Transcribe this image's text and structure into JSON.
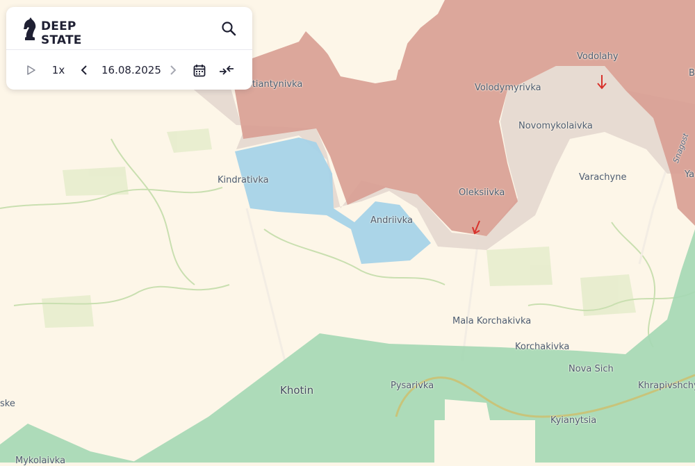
{
  "app": {
    "logo_line1": "DEEP",
    "logo_line2": "STATE"
  },
  "controls": {
    "playback_speed": "1x",
    "date": "16.08.2025"
  },
  "icons": [
    "knight-logo-icon",
    "search-icon",
    "play-icon",
    "chevron-left-icon",
    "chevron-right-icon",
    "calendar-icon",
    "compress-arrows-icon",
    "movement-arrow-icon"
  ],
  "colors": {
    "background": "#fdf6e8",
    "occupied": "#d9a094",
    "contested": "#e4d8cf",
    "liberated": "#a7d3e8",
    "ukraine_controlled": "#a6d8b4",
    "arrow": "#d8312b"
  },
  "map": {
    "places": [
      {
        "id": "kostiantynivka",
        "label": "stiantynivka"
      },
      {
        "id": "vodolahy",
        "label": "Vodolahy"
      },
      {
        "id": "volodymyrivka",
        "label": "Volodymyrivka"
      },
      {
        "id": "novomykolaivka",
        "label": "Novomykolaivka"
      },
      {
        "id": "kindrativka",
        "label": "Kindrativka"
      },
      {
        "id": "varachyne",
        "label": "Varachyne"
      },
      {
        "id": "oleksiivka",
        "label": "Oleksiivka"
      },
      {
        "id": "andriivka",
        "label": "Andriivka"
      },
      {
        "id": "mala-korchakivka",
        "label": "Mala Korchakivka"
      },
      {
        "id": "korchakivka",
        "label": "Korchakivka"
      },
      {
        "id": "nova-sich",
        "label": "Nova Sich"
      },
      {
        "id": "khotin",
        "label": "Khotin"
      },
      {
        "id": "pysarivka",
        "label": "Pysarivka"
      },
      {
        "id": "khrapivshchyna",
        "label": "Khrapivshchy"
      },
      {
        "id": "kyianytsia",
        "label": "Kyianytsia"
      },
      {
        "id": "yablunivka",
        "label": "Ya"
      },
      {
        "id": "b-edge",
        "label": "B"
      },
      {
        "id": "sske",
        "label": "ske"
      },
      {
        "id": "mykolaivka",
        "label": "Mykolaivka"
      },
      {
        "id": "sinyak",
        "label": "Snagost"
      }
    ]
  }
}
